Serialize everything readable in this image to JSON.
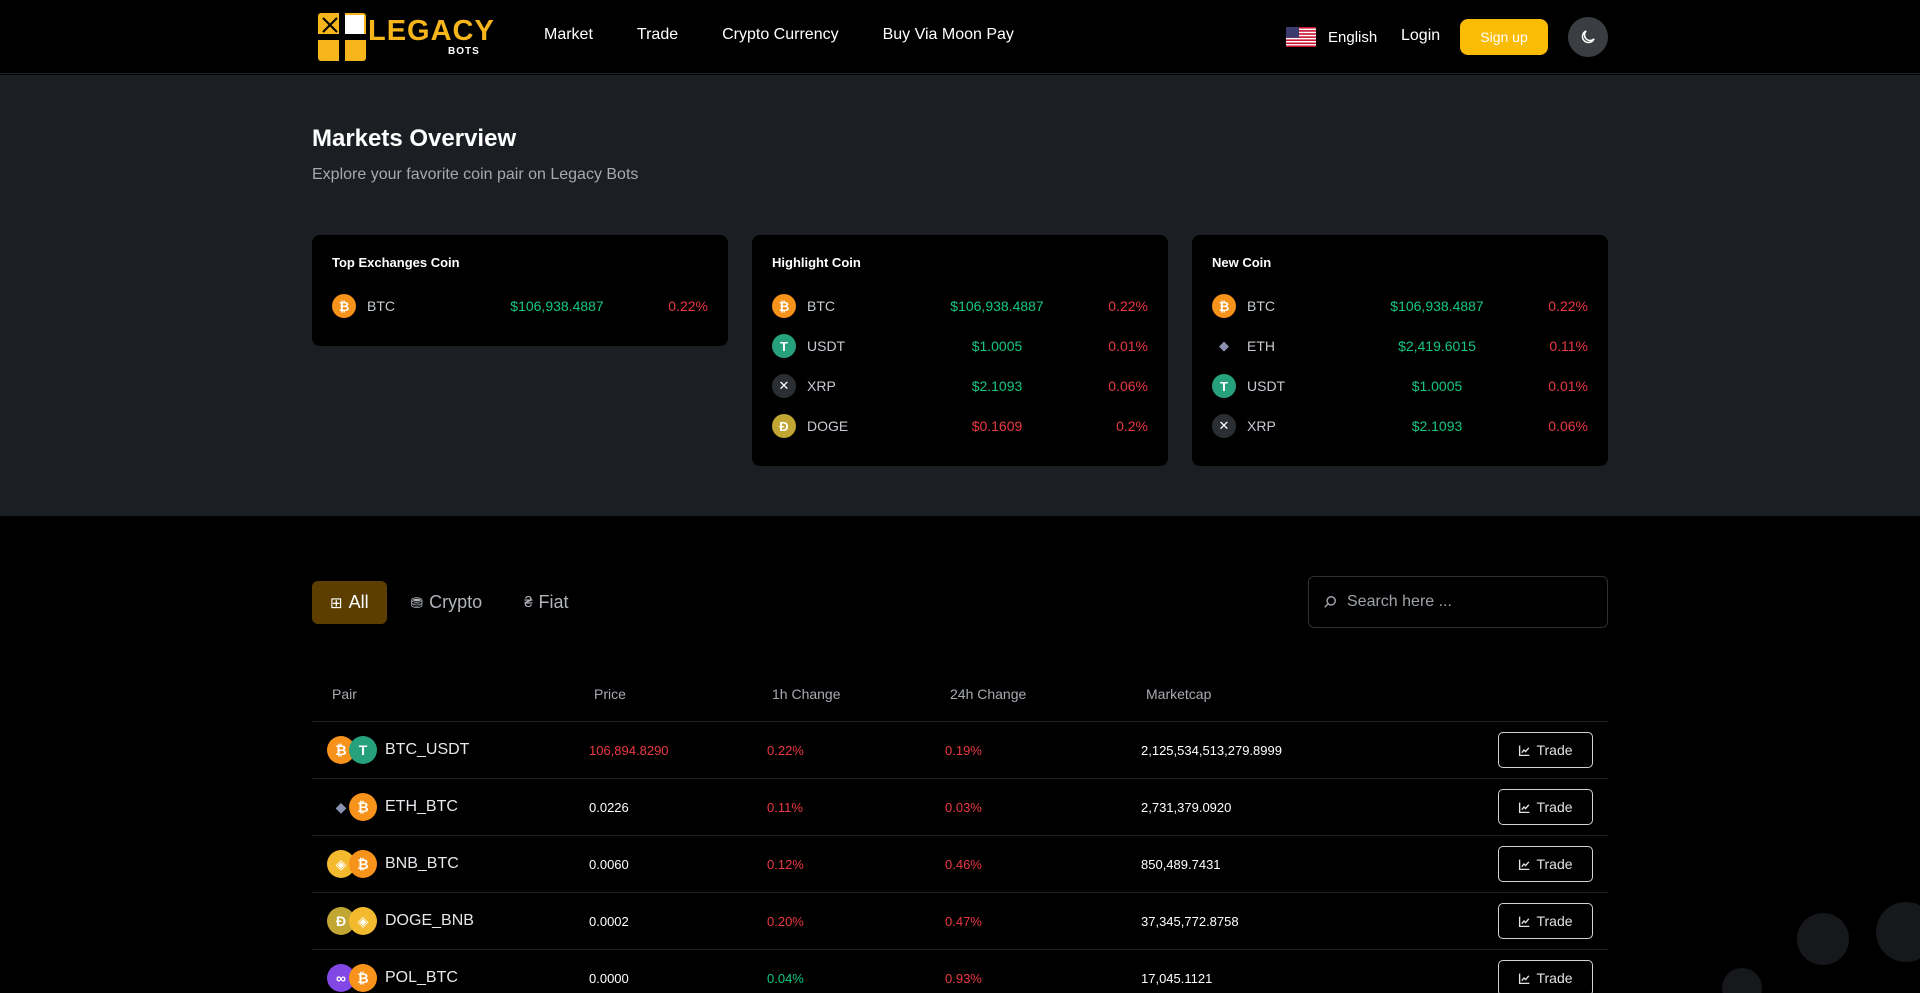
{
  "header": {
    "logo_word": "LEGACY",
    "logo_sub": "BOTS",
    "nav": [
      "Market",
      "Trade",
      "Crypto Currency",
      "Buy Via Moon Pay"
    ],
    "language": "English",
    "login": "Login",
    "signup": "Sign up"
  },
  "overview": {
    "title": "Markets Overview",
    "subtitle": "Explore your favorite coin pair on Legacy Bots",
    "cards": [
      {
        "title": "Top Exchanges Coin",
        "rows": [
          {
            "symbol": "BTC",
            "price": "$106,938.4887",
            "change": "0.22%",
            "icon": "bitcoin-icon"
          }
        ]
      },
      {
        "title": "Highlight Coin",
        "rows": [
          {
            "symbol": "BTC",
            "price": "$106,938.4887",
            "change": "0.22%",
            "icon": "bitcoin-icon"
          },
          {
            "symbol": "USDT",
            "price": "$1.0005",
            "change": "0.01%",
            "icon": "tether-icon"
          },
          {
            "symbol": "XRP",
            "price": "$2.1093",
            "change": "0.06%",
            "icon": "xrp-icon"
          },
          {
            "symbol": "DOGE",
            "price": "$0.1609",
            "change": "0.2%",
            "icon": "doge-icon",
            "price_color": "red"
          }
        ]
      },
      {
        "title": "New Coin",
        "rows": [
          {
            "symbol": "BTC",
            "price": "$106,938.4887",
            "change": "0.22%",
            "icon": "bitcoin-icon"
          },
          {
            "symbol": "ETH",
            "price": "$2,419.6015",
            "change": "0.11%",
            "icon": "ethereum-icon"
          },
          {
            "symbol": "USDT",
            "price": "$1.0005",
            "change": "0.01%",
            "icon": "tether-icon"
          },
          {
            "symbol": "XRP",
            "price": "$2.1093",
            "change": "0.06%",
            "icon": "xrp-icon"
          }
        ]
      }
    ]
  },
  "tabs": [
    {
      "label": "All",
      "icon": "grid-icon",
      "active": true
    },
    {
      "label": "Crypto",
      "icon": "coins-icon",
      "active": false
    },
    {
      "label": "Fiat",
      "icon": "currency-icon",
      "active": false
    }
  ],
  "search": {
    "placeholder": "Search here ..."
  },
  "table": {
    "headers": {
      "pair": "Pair",
      "price": "Price",
      "h1": "1h Change",
      "h24": "24h Change",
      "cap": "Marketcap"
    },
    "trade_label": "Trade",
    "rows": [
      {
        "pair": "BTC_USDT",
        "price": "106,894.8290",
        "price_color": "red",
        "h1": "0.22%",
        "h1_color": "red",
        "h24": "0.19%",
        "h24_color": "red",
        "cap": "2,125,534,513,279.8999",
        "icons": [
          "bitcoin-icon",
          "tether-icon"
        ]
      },
      {
        "pair": "ETH_BTC",
        "price": "0.0226",
        "price_color": "white",
        "h1": "0.11%",
        "h1_color": "red",
        "h24": "0.03%",
        "h24_color": "red",
        "cap": "2,731,379.0920",
        "icons": [
          "ethereum-icon",
          "bitcoin-icon"
        ]
      },
      {
        "pair": "BNB_BTC",
        "price": "0.0060",
        "price_color": "white",
        "h1": "0.12%",
        "h1_color": "red",
        "h24": "0.46%",
        "h24_color": "red",
        "cap": "850,489.7431",
        "icons": [
          "bnb-icon",
          "bitcoin-icon"
        ]
      },
      {
        "pair": "DOGE_BNB",
        "price": "0.0002",
        "price_color": "white",
        "h1": "0.20%",
        "h1_color": "red",
        "h24": "0.47%",
        "h24_color": "red",
        "cap": "37,345,772.8758",
        "icons": [
          "doge-icon",
          "bnb-icon"
        ]
      },
      {
        "pair": "POL_BTC",
        "price": "0.0000",
        "price_color": "white",
        "h1": "0.04%",
        "h1_color": "green",
        "h24": "0.93%",
        "h24_color": "red",
        "cap": "17,045.1121",
        "icons": [
          "polygon-icon",
          "bitcoin-icon"
        ]
      }
    ]
  },
  "colors": {
    "accent": "#fbbc05",
    "up": "#16c784",
    "down": "#ea3943",
    "overview_bg": "#1b1e22"
  }
}
